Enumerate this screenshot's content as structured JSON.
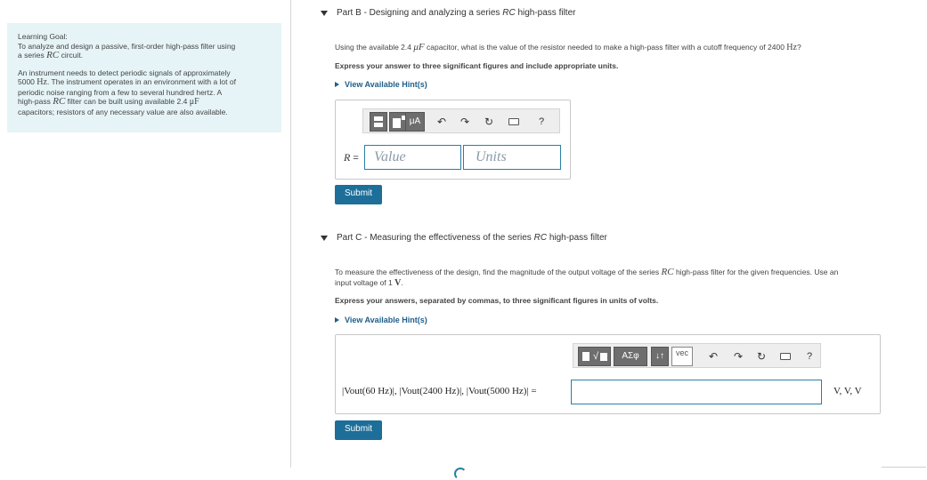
{
  "sidebar": {
    "goal_title": "Learning Goal:",
    "goal_text_1": "To analyze and design a passive, first-order high-pass filter using",
    "goal_text_2": "a series",
    "goal_rc": "RC",
    "goal_text_3": "circuit.",
    "para_1": "An instrument needs to detect periodic signals of approximately",
    "para_2_num": "5000",
    "para_2_unit": "Hz",
    "para_2_rest": ". The instrument operates in an environment with a lot of",
    "para_3": "periodic noise ranging from a few to several hundred hertz. A",
    "para_4a": "high-pass",
    "para_4_rc": "RC",
    "para_4b": "filter can be built using available 2.4",
    "para_4_unit": "μF",
    "para_5": "capacitors; resistors of any necessary value are also available."
  },
  "partB": {
    "title_prefix": "Part B - Designing and analyzing a series ",
    "title_rc": "RC",
    "title_suffix": " high-pass filter",
    "question_a": "Using the available 2.4 ",
    "question_unit": "μF",
    "question_b": " capacitor, what is the value of the resistor needed to make a high-pass filter with a cutoff frequency of 2400 ",
    "question_hz": "Hz",
    "question_c": "?",
    "instruction": "Express your answer to three significant figures and include appropriate units.",
    "hint_label": "View Available Hint(s)",
    "toolbar_mu": "μA",
    "toolbar_help": "?",
    "var_label": "R =",
    "value_placeholder": "Value",
    "units_placeholder": "Units",
    "submit_label": "Submit"
  },
  "partC": {
    "title_prefix": "Part C - Measuring the effectiveness of the series ",
    "title_rc": "RC",
    "title_suffix": " high-pass filter",
    "question_a": "To measure the effectiveness of the design, find the magnitude of the output voltage of the series ",
    "question_rc": "RC",
    "question_b": " high-pass filter for the given frequencies. Use an",
    "question_c": "input voltage of 1 ",
    "question_v": "V",
    "question_d": ".",
    "instruction": "Express your answers, separated by commas, to three significant figures in units of volts.",
    "hint_label": "View Available Hint(s)",
    "toolbar_sym": "ΑΣφ",
    "toolbar_vec": "vec",
    "toolbar_help": "?",
    "expr_label": "|Vout(60 Hz)|, |Vout(2400 Hz)|, |Vout(5000 Hz)| =",
    "units_suffix": "V, V, V",
    "submit_label": "Submit"
  }
}
